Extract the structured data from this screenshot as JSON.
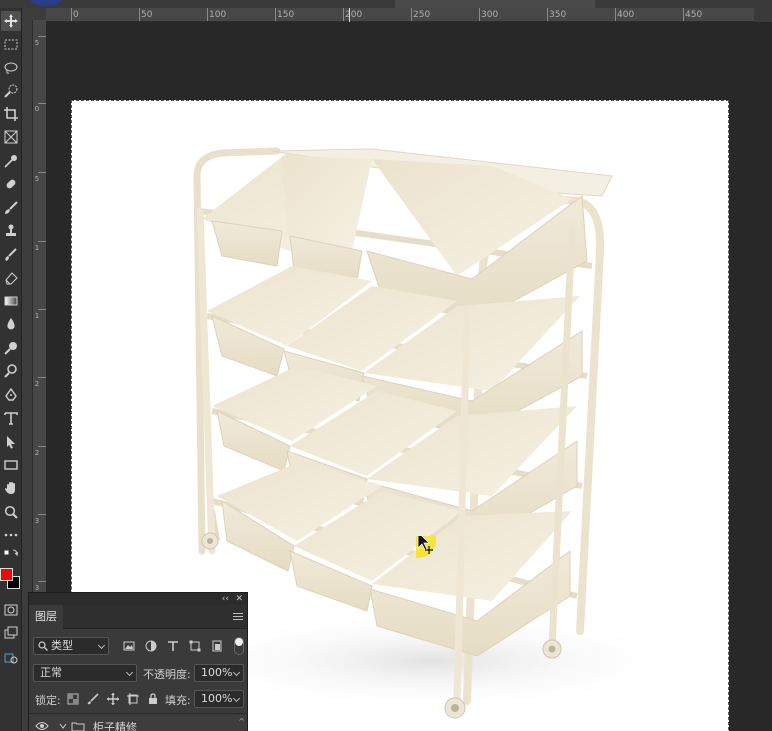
{
  "app": {
    "name": "Photoshop"
  },
  "ruler": {
    "h_labels": [
      "0",
      "50",
      "100",
      "150",
      "200",
      "250",
      "300",
      "350",
      "400",
      "450"
    ],
    "v_labels": [
      "5",
      "0",
      "5",
      "1",
      "1",
      "2",
      "2",
      "3",
      "3"
    ]
  },
  "toolbar": {
    "tools": [
      "move-tool",
      "marquee-tool",
      "lasso-tool",
      "quick-select-tool",
      "crop-tool",
      "frame-tool",
      "eyedropper-tool",
      "healing-tool",
      "brush-tool",
      "clone-stamp-tool",
      "history-brush-tool",
      "eraser-tool",
      "gradient-tool",
      "blur-tool",
      "dodge-tool",
      "pen-tool",
      "type-tool",
      "path-select-tool",
      "rectangle-tool",
      "hand-tool",
      "zoom-tool",
      "more-tools"
    ],
    "foreground_color": "#ff0000",
    "background_color": "#000000"
  },
  "canvas": {
    "background": "#ffffff",
    "product": "shelf-with-bins-image"
  },
  "layers_panel": {
    "tab_label": "图层",
    "filter_kind": "类型",
    "blend_mode": "正常",
    "opacity_label": "不透明度:",
    "opacity_value": "100%",
    "lock_label": "锁定:",
    "fill_label": "填充:",
    "fill_value": "100%",
    "layer_name": "柜子精修"
  }
}
